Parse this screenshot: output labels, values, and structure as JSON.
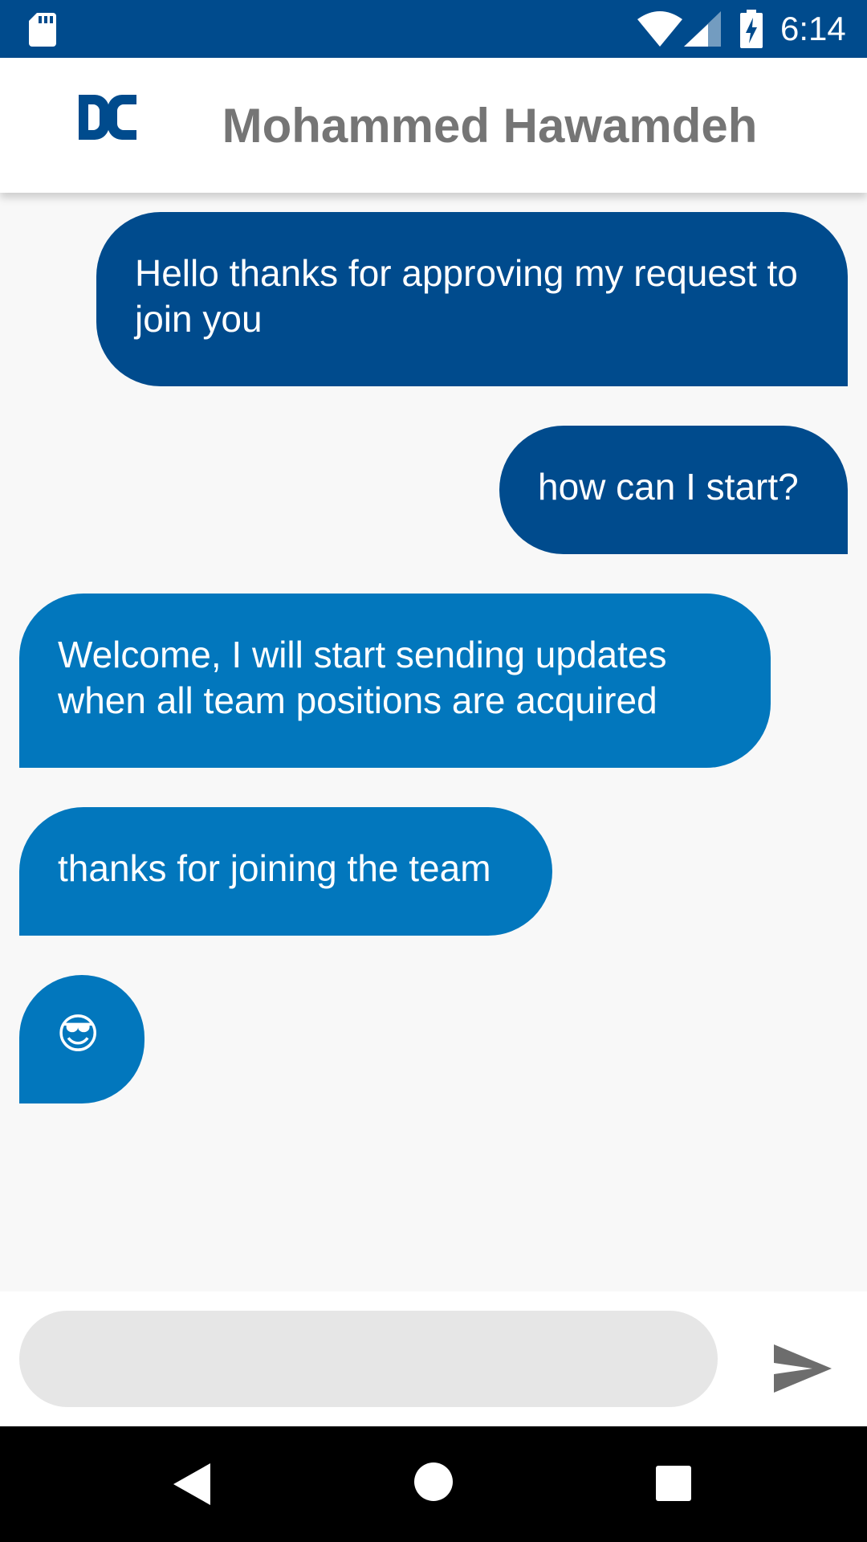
{
  "status_bar": {
    "time": "6:14",
    "icons": [
      "sd-card-icon",
      "wifi-icon",
      "cell-signal-icon",
      "battery-charging-icon"
    ]
  },
  "header": {
    "logo_text": "DC",
    "title": "Mohammed Hawamdeh"
  },
  "messages": [
    {
      "direction": "outgoing",
      "text": "Hello thanks for approving my request to join you"
    },
    {
      "direction": "outgoing",
      "text": "how can I start?"
    },
    {
      "direction": "incoming",
      "text": "Welcome, I will start sending updates when all team positions are acquired"
    },
    {
      "direction": "incoming",
      "text": "thanks for joining the team"
    },
    {
      "direction": "incoming",
      "text": "😎"
    }
  ],
  "composer": {
    "input_value": "",
    "send_icon": "send-icon"
  },
  "nav_bar": {
    "icons": [
      "back-icon",
      "home-icon",
      "recents-icon"
    ]
  },
  "colors": {
    "status_bar": "#004b8d",
    "outgoing_bubble": "#004b8d",
    "incoming_bubble": "#0277bd",
    "header_title": "#757575",
    "input_background": "#e6e6e6"
  }
}
